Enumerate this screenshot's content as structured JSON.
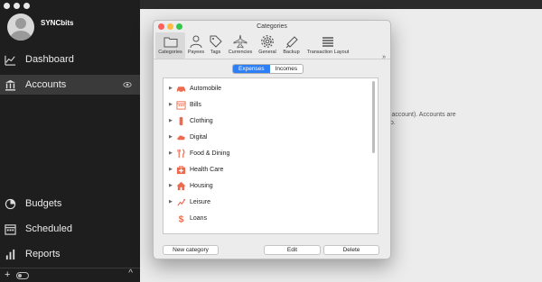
{
  "app": {
    "username": "SYNCbits"
  },
  "sidebar": {
    "items": [
      {
        "label": "Dashboard",
        "icon": "chart-icon"
      },
      {
        "label": "Accounts",
        "icon": "bank-icon"
      },
      {
        "label": "Budgets",
        "icon": "pie-icon"
      },
      {
        "label": "Scheduled",
        "icon": "calendar-icon"
      },
      {
        "label": "Reports",
        "icon": "bars-icon"
      }
    ],
    "footer": {
      "add_label": "+",
      "collapse_label": "^"
    }
  },
  "background": {
    "text_line1": "k account). Accounts are",
    "text_line2": "go."
  },
  "dialog": {
    "title": "Categories",
    "toolbar": [
      {
        "label": "Categories",
        "icon": "folder-icon"
      },
      {
        "label": "Payees",
        "icon": "person-icon"
      },
      {
        "label": "Tags",
        "icon": "tag-icon"
      },
      {
        "label": "Currencies",
        "icon": "airplane-icon"
      },
      {
        "label": "General",
        "icon": "gear-icon"
      },
      {
        "label": "Backup",
        "icon": "backup-icon"
      },
      {
        "label": "Transaction Layout",
        "icon": "list-icon"
      }
    ],
    "more_label": "»",
    "segments": {
      "expenses": "Expenses",
      "incomes": "Incomes"
    },
    "categories": [
      {
        "label": "Automobile",
        "icon": "car-icon"
      },
      {
        "label": "Bills",
        "icon": "calendar-icon"
      },
      {
        "label": "Clothing",
        "icon": "clothing-icon"
      },
      {
        "label": "Digital",
        "icon": "cloud-icon"
      },
      {
        "label": "Food & Dining",
        "icon": "utensils-icon"
      },
      {
        "label": "Health Care",
        "icon": "medical-icon"
      },
      {
        "label": "Housing",
        "icon": "house-icon"
      },
      {
        "label": "Leisure",
        "icon": "leisure-icon"
      },
      {
        "label": "Loans",
        "icon": "dollar-icon"
      }
    ],
    "buttons": {
      "new_category": "New category",
      "edit": "Edit",
      "delete": "Delete"
    }
  },
  "colors": {
    "sidebar": "#1e1e1e",
    "accent": "#2e7ff6",
    "category_icon": "#ee6a4f"
  }
}
